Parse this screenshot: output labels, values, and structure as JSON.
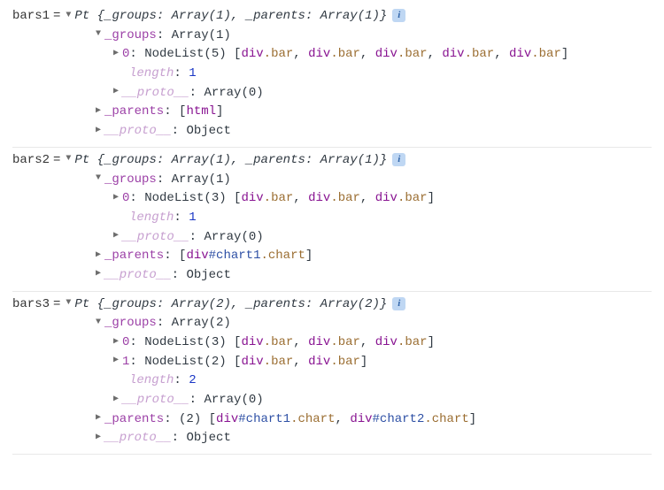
{
  "entries": [
    {
      "var": "bars1",
      "ctor": "Pt",
      "summary": "{_groups: Array(1), _parents: Array(1)}",
      "groupsLabel": "_groups",
      "groupsHead": "Array(1)",
      "groupItems": [
        {
          "idx": "0",
          "head": "NodeList(5)",
          "members": "[div.bar, div.bar, div.bar, div.bar, div.bar]"
        }
      ],
      "lengthLabel": "length",
      "lengthVal": "1",
      "protoArrLabel": "__proto__",
      "protoArr": "Array(0)",
      "parentsLabel": "_parents",
      "parentsVal": "[html]",
      "protoObjLabel": "__proto__",
      "protoObj": "Object"
    },
    {
      "var": "bars2",
      "ctor": "Pt",
      "summary": "{_groups: Array(1), _parents: Array(1)}",
      "groupsLabel": "_groups",
      "groupsHead": "Array(1)",
      "groupItems": [
        {
          "idx": "0",
          "head": "NodeList(3)",
          "members": "[div.bar, div.bar, div.bar]"
        }
      ],
      "lengthLabel": "length",
      "lengthVal": "1",
      "protoArrLabel": "__proto__",
      "protoArr": "Array(0)",
      "parentsLabel": "_parents",
      "parentsVal": "[div#chart1.chart]",
      "protoObjLabel": "__proto__",
      "protoObj": "Object"
    },
    {
      "var": "bars3",
      "ctor": "Pt",
      "summary": "{_groups: Array(2), _parents: Array(2)}",
      "groupsLabel": "_groups",
      "groupsHead": "Array(2)",
      "groupItems": [
        {
          "idx": "0",
          "head": "NodeList(3)",
          "members": "[div.bar, div.bar, div.bar]"
        },
        {
          "idx": "1",
          "head": "NodeList(2)",
          "members": "[div.bar, div.bar]"
        }
      ],
      "lengthLabel": "length",
      "lengthVal": "2",
      "protoArrLabel": "__proto__",
      "protoArr": "Array(0)",
      "parentsLabel": "_parents",
      "parentsVal": "(2) [div#chart1.chart, div#chart2.chart]",
      "protoObjLabel": "__proto__",
      "protoObj": "Object"
    }
  ],
  "infoBadge": "i"
}
